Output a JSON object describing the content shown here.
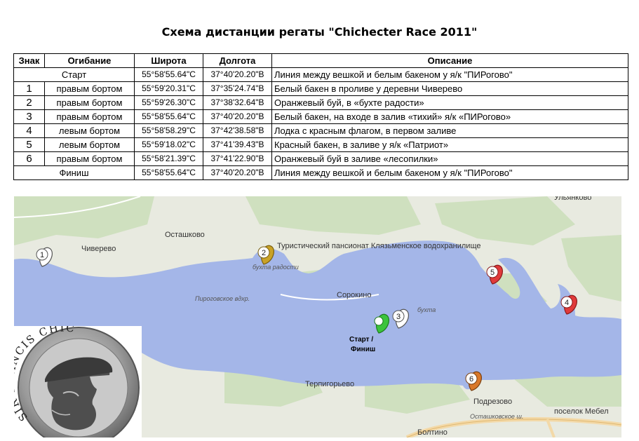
{
  "title": "Схема дистанции регаты \"Chichecter Race 2011\"",
  "table": {
    "headers": [
      "Знак",
      "Огибание",
      "Широта",
      "Долгота",
      "Описание"
    ],
    "rows": [
      {
        "mark": "",
        "rounding": "Старт",
        "lat": "55°58'55.64\"С",
        "lon": "37°40'20.20\"В",
        "desc": "Линия между вешкой и белым бакеном у я/к \"ПИРогово\""
      },
      {
        "mark": "1",
        "rounding": "правым бортом",
        "lat": "55°59'20.31\"С",
        "lon": "37°35'24.74\"В",
        "desc": "Белый бакен  в проливе у деревни Чиверево"
      },
      {
        "mark": "2",
        "rounding": "правым бортом",
        "lat": "55°59'26.30\"С",
        "lon": "37°38'32.64\"В",
        "desc": "Оранжевый буй, в «бухте радости»"
      },
      {
        "mark": "3",
        "rounding": "правым бортом",
        "lat": "55°58'55.64\"С",
        "lon": "37°40'20.20\"В",
        "desc": "Белый бакен, на входе в залив «тихий»  я/к «ПИРогово»"
      },
      {
        "mark": "4",
        "rounding": "левым бортом",
        "lat": "55°58'58.29\"С",
        "lon": "37°42'38.58\"В",
        "desc": "Лодка с красным флагом, в первом заливе"
      },
      {
        "mark": "5",
        "rounding": "левым бортом",
        "lat": "55°59'18.02\"С",
        "lon": "37°41'39.43\"В",
        "desc": "Красный бакен, в заливе у я/к «Патриот»"
      },
      {
        "mark": "6",
        "rounding": "правым бортом",
        "lat": "55°58'21.39\"С",
        "lon": "37°41'22.90\"В",
        "desc": "Оранжевый буй в заливе «лесопилки»"
      },
      {
        "mark": "",
        "rounding": "Финиш",
        "lat": "55°58'55.64\"С",
        "lon": "37°40'20.20\"В",
        "desc": "Линия между вешкой и белым бакеном у я/к \"ПИРогово\""
      }
    ]
  },
  "map": {
    "labels": {
      "ulyankovo": "Ульянково",
      "ostashkovo": "Осташково",
      "chiverevo": "Чиверево",
      "pansionat": "Туристический пансионат Клязьменское водохранилище",
      "bukhta_radosti": "бухта радости",
      "pirogovskoe": "Пироговское вдхр.",
      "sorokino": "Сорокино",
      "bukhta": "бухта",
      "start_finish_1": "Старт /",
      "start_finish_2": "Финиш",
      "terpigorevo": "Терпигорьево",
      "podrezovo": "Подрезово",
      "poselok": "поселок Мебел",
      "ostashkovskoe": "Осташковское ш.",
      "boltino": "Болтино"
    },
    "markers": [
      {
        "label": "1",
        "color": "#ffffff"
      },
      {
        "label": "2",
        "color": "#c9a227"
      },
      {
        "label": "3",
        "color": "#ffffff"
      },
      {
        "label": "4",
        "color": "#e03a3a"
      },
      {
        "label": "5",
        "color": "#e03a3a"
      },
      {
        "label": "6",
        "color": "#d9782a"
      },
      {
        "label": "",
        "color": "#3cc43c"
      }
    ]
  },
  "medal": {
    "text": "SIR FRANCIS CHICHESTER"
  },
  "colors": {
    "water": "#a4b6e8",
    "land": "#e8eae0",
    "forest": "#cfe0bf",
    "road": "#f3d9a8"
  }
}
